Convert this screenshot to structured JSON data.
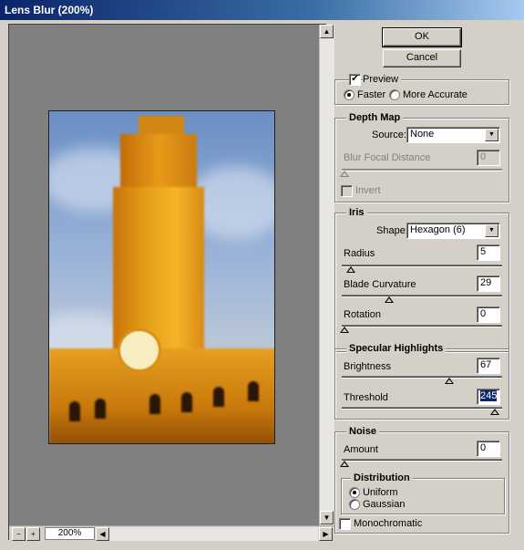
{
  "window": {
    "title": "Lens Blur (200%)"
  },
  "buttons": {
    "ok": "OK",
    "cancel": "Cancel"
  },
  "preview": {
    "label": "Preview",
    "checked": true,
    "faster": "Faster",
    "more_accurate": "More Accurate",
    "selected": "Faster"
  },
  "zoom": {
    "minus": "−",
    "plus": "+",
    "value": "200%"
  },
  "depth_map": {
    "title": "Depth Map",
    "source_label": "Source:",
    "source_value": "None",
    "blur_focal_label": "Blur Focal Distance",
    "blur_focal_value": "0",
    "invert_label": "Invert"
  },
  "iris": {
    "title": "Iris",
    "shape_label": "Shape:",
    "shape_value": "Hexagon (6)",
    "radius_label": "Radius",
    "radius_value": "5",
    "blade_label": "Blade Curvature",
    "blade_value": "29",
    "rotation_label": "Rotation",
    "rotation_value": "0"
  },
  "specular": {
    "title": "Specular Highlights",
    "brightness_label": "Brightness",
    "brightness_value": "67",
    "threshold_label": "Threshold",
    "threshold_value": "245"
  },
  "noise": {
    "title": "Noise",
    "amount_label": "Amount",
    "amount_value": "0",
    "distribution_title": "Distribution",
    "uniform": "Uniform",
    "gaussian": "Gaussian",
    "selected": "Uniform",
    "mono_label": "Monochromatic",
    "mono_checked": false
  }
}
